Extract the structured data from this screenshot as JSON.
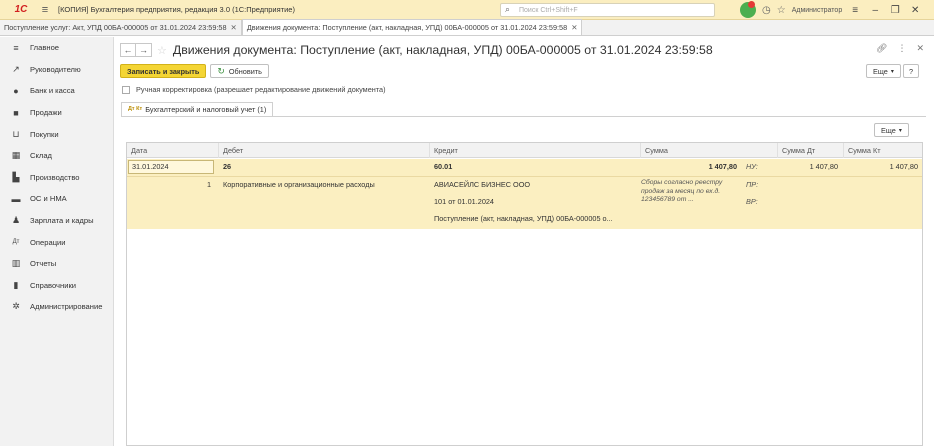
{
  "titlebar": {
    "logo": "1С",
    "title": "[КОПИЯ] Бухгалтерия предприятия, редакция 3.0  (1С:Предприятие)",
    "search_placeholder": "Поиск Ctrl+Shift+F",
    "username": "Администратор"
  },
  "tabs": [
    {
      "label": "Поступление услуг: Акт, УПД 00БА-000005 от 31.01.2024 23:59:58"
    },
    {
      "label": "Движения документа: Поступление (акт, накладная, УПД) 00БА-000005 от 31.01.2024 23:59:58"
    }
  ],
  "sidebar": {
    "items": [
      {
        "label": "Главное",
        "icon": "menu-icon"
      },
      {
        "label": "Руководителю",
        "icon": "chart-line-icon"
      },
      {
        "label": "Банк и касса",
        "icon": "coins-icon"
      },
      {
        "label": "Продажи",
        "icon": "shopping-bag-icon"
      },
      {
        "label": "Покупки",
        "icon": "cart-icon"
      },
      {
        "label": "Склад",
        "icon": "warehouse-icon"
      },
      {
        "label": "Производство",
        "icon": "factory-icon"
      },
      {
        "label": "ОС и НМА",
        "icon": "truck-icon"
      },
      {
        "label": "Зарплата и кадры",
        "icon": "person-icon"
      },
      {
        "label": "Операции",
        "icon": "dt-kt-icon"
      },
      {
        "label": "Отчеты",
        "icon": "bar-chart-icon"
      },
      {
        "label": "Справочники",
        "icon": "book-icon"
      },
      {
        "label": "Администрирование",
        "icon": "gear-icon"
      }
    ]
  },
  "form": {
    "title": "Движения документа: Поступление (акт, накладная, УПД) 00БА-000005 от 31.01.2024 23:59:58",
    "save_close_label": "Записать и закрыть",
    "refresh_label": "Обновить",
    "more_label": "Еще",
    "help_label": "?",
    "manual_edit_label": "Ручная корректировка (разрешает редактирование движений документа)",
    "subtab_label": "Бухгалтерский и налоговый учет (1)",
    "subtab_icon_text": "Дт Кт"
  },
  "table": {
    "headers": {
      "date": "Дата",
      "debit": "Дебет",
      "credit": "Кредит",
      "amount": "Сумма",
      "amount_dt": "Сумма Дт",
      "amount_kt": "Сумма Кт"
    },
    "row": {
      "date": "31.01.2024",
      "debit_account": "26",
      "number": "1",
      "debit_subconto": "Корпоративные и организационные расходы",
      "credit_account": "60.01",
      "credit_sub1": "АВИАСЕЙЛС БИЗНЕС ООО",
      "credit_sub2": "101 от 01.01.2024",
      "credit_sub3": "Поступление (акт, накладная, УПД) 00БА-000005 о...",
      "amount": "1 407,80",
      "description": "Сборы согласно реестру продаж за месяц по ех.д. 123456789 от ...",
      "nu_label": "НУ:",
      "pr_label": "ПР:",
      "vr_label": "ВР:",
      "amount_dt": "1 407,80",
      "amount_kt": "1 407,80"
    }
  }
}
